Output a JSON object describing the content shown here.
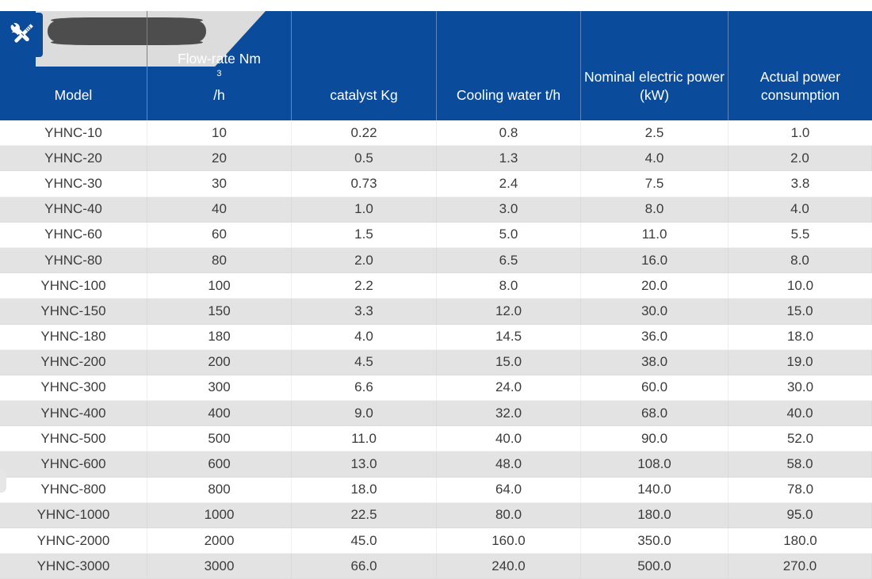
{
  "header": {
    "banner_icon": "wrench-screwdriver-icon",
    "banner_title_redacted": "",
    "accent_color": "#0A4C9B",
    "banner_color": "#DCDCDC",
    "redaction_color": "#4D4D4D"
  },
  "table": {
    "columns": [
      {
        "label": "Model",
        "sup": ""
      },
      {
        "label": "Flow-rate Nm",
        "sup": "3",
        "suffix": "/h"
      },
      {
        "label": "catalyst Kg",
        "sup": ""
      },
      {
        "label": "Cooling water t/h",
        "sup": ""
      },
      {
        "label": "Nominal electric power (kW)",
        "sup": ""
      },
      {
        "label": "Actual power consumption",
        "sup": ""
      }
    ],
    "rows": [
      [
        "YHNC-10",
        "10",
        "0.22",
        "0.8",
        "2.5",
        "1.0"
      ],
      [
        "YHNC-20",
        "20",
        "0.5",
        "1.3",
        "4.0",
        "2.0"
      ],
      [
        "YHNC-30",
        "30",
        "0.73",
        "2.4",
        "7.5",
        "3.8"
      ],
      [
        "YHNC-40",
        "40",
        "1.0",
        "3.0",
        "8.0",
        "4.0"
      ],
      [
        "YHNC-60",
        "60",
        "1.5",
        "5.0",
        "11.0",
        "5.5"
      ],
      [
        "YHNC-80",
        "80",
        "2.0",
        "6.5",
        "16.0",
        "8.0"
      ],
      [
        "YHNC-100",
        "100",
        "2.2",
        "8.0",
        "20.0",
        "10.0"
      ],
      [
        "YHNC-150",
        "150",
        "3.3",
        "12.0",
        "30.0",
        "15.0"
      ],
      [
        "YHNC-180",
        "180",
        "4.0",
        "14.5",
        "36.0",
        "18.0"
      ],
      [
        "YHNC-200",
        "200",
        "4.5",
        "15.0",
        "38.0",
        "19.0"
      ],
      [
        "YHNC-300",
        "300",
        "6.6",
        "24.0",
        "60.0",
        "30.0"
      ],
      [
        "YHNC-400",
        "400",
        "9.0",
        "32.0",
        "68.0",
        "40.0"
      ],
      [
        "YHNC-500",
        "500",
        "11.0",
        "40.0",
        "90.0",
        "52.0"
      ],
      [
        "YHNC-600",
        "600",
        "13.0",
        "48.0",
        "108.0",
        "58.0"
      ],
      [
        "YHNC-800",
        "800",
        "18.0",
        "64.0",
        "140.0",
        "78.0"
      ],
      [
        "YHNC-1000",
        "1000",
        "22.5",
        "80.0",
        "180.0",
        "95.0"
      ],
      [
        "YHNC-2000",
        "2000",
        "45.0",
        "160.0",
        "350.0",
        "180.0"
      ],
      [
        "YHNC-3000",
        "3000",
        "66.0",
        "240.0",
        "500.0",
        "270.0"
      ]
    ]
  }
}
